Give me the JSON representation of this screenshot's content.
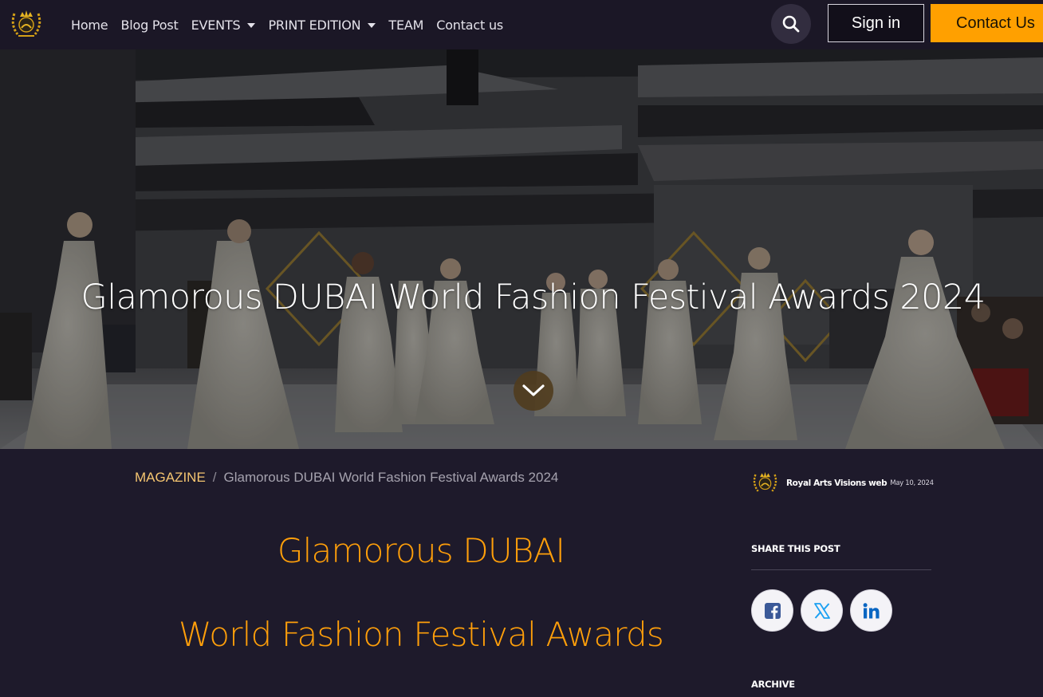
{
  "header": {
    "logo_icon": "crown-laurel-crest-icon",
    "nav": [
      {
        "label": "Home",
        "dropdown": false
      },
      {
        "label": "Blog Post",
        "dropdown": false
      },
      {
        "label": "EVENTS",
        "dropdown": true
      },
      {
        "label": "PRINT EDITION",
        "dropdown": true
      },
      {
        "label": "TEAM",
        "dropdown": false
      },
      {
        "label": "Contact us",
        "dropdown": false
      }
    ],
    "search_icon": "search-icon",
    "signin_label": "Sign in",
    "contact_label": "Contact Us"
  },
  "hero": {
    "title": "Glamorous DUBAI World Fashion Festival Awards 2024",
    "scroll_icon": "chevron-down-icon"
  },
  "breadcrumb": {
    "link": "MAGAZINE",
    "separator": "/",
    "current": "Glamorous DUBAI World Fashion Festival Awards 2024"
  },
  "author": {
    "name": "Royal Arts Visions web",
    "date": "May 10, 2024"
  },
  "article": {
    "title_line1": "Glamorous DUBAI",
    "title_line2": "World Fashion Festival Awards"
  },
  "sidebar": {
    "share_heading": "SHARE THIS POST",
    "share_buttons": [
      "facebook-icon",
      "x-twitter-icon",
      "linkedin-icon"
    ],
    "archive_heading": "ARCHIVE"
  },
  "colors": {
    "page_bg": "#1e1a2b",
    "navbar_bg": "#1b1726",
    "accent_orange": "#ff9f0a",
    "button_orange": "#ffa000",
    "breadcrumb_link": "#f5c570",
    "facebook_blue": "#3b5998",
    "twitter_blue": "#1da1f2",
    "linkedin_blue": "#0a66c2"
  }
}
